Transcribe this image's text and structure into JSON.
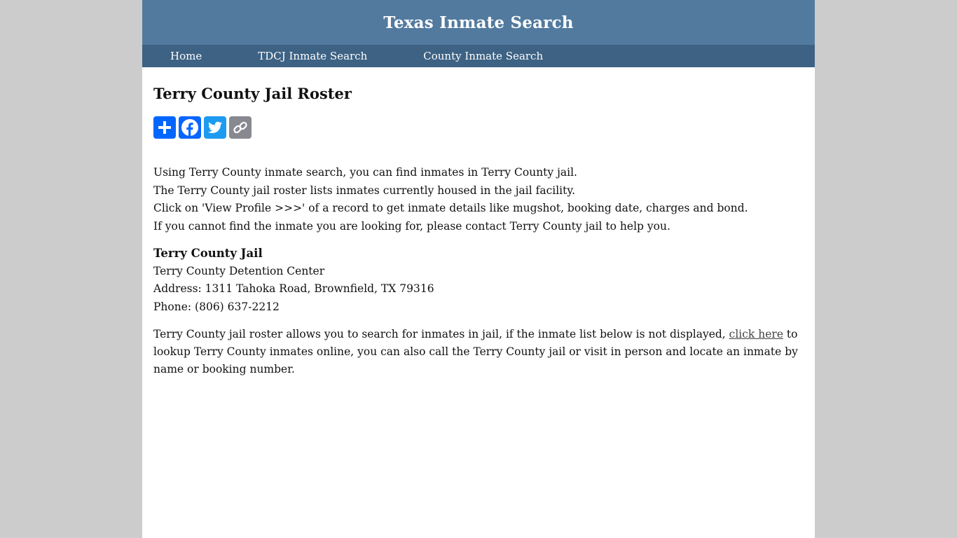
{
  "header": {
    "site_title": "Texas Inmate Search"
  },
  "nav": {
    "items": [
      {
        "label": "Home"
      },
      {
        "label": "TDCJ Inmate Search"
      },
      {
        "label": "County Inmate Search"
      }
    ]
  },
  "main": {
    "page_title": "Terry County Jail Roster",
    "share_buttons": [
      {
        "icon": "plus-icon",
        "color": "#0166ff"
      },
      {
        "icon": "facebook-icon",
        "color": "#0866ff"
      },
      {
        "icon": "twitter-icon",
        "color": "#1d9bf0"
      },
      {
        "icon": "link-icon",
        "color": "#888990"
      }
    ],
    "intro_lines": [
      "Using Terry County inmate search, you can find inmates in Terry County jail.",
      "The Terry County jail roster lists inmates currently housed in the jail facility.",
      "Click on 'View Profile >>>' of a record to get inmate details like mugshot, booking date, charges and bond.",
      "If you cannot find the inmate you are looking for, please contact Terry County jail to help you."
    ],
    "jail": {
      "name": "Terry County Jail",
      "facility": "Terry County Detention Center",
      "address": "Address: 1311 Tahoka Road, Brownfield, TX 79316",
      "phone": "Phone: (806) 637-2212"
    },
    "roster_note": {
      "before_link": "Terry County jail roster allows you to search for inmates in jail, if the inmate list below is not displayed, ",
      "link_text": "click here",
      "after_link": " to lookup Terry County inmates online, you can also call the Terry County jail or visit in person and locate an inmate by name or booking number."
    }
  },
  "colors": {
    "header_bg": "#527a9e",
    "nav_bg": "#3d6283",
    "page_bg": "#cccccc"
  }
}
